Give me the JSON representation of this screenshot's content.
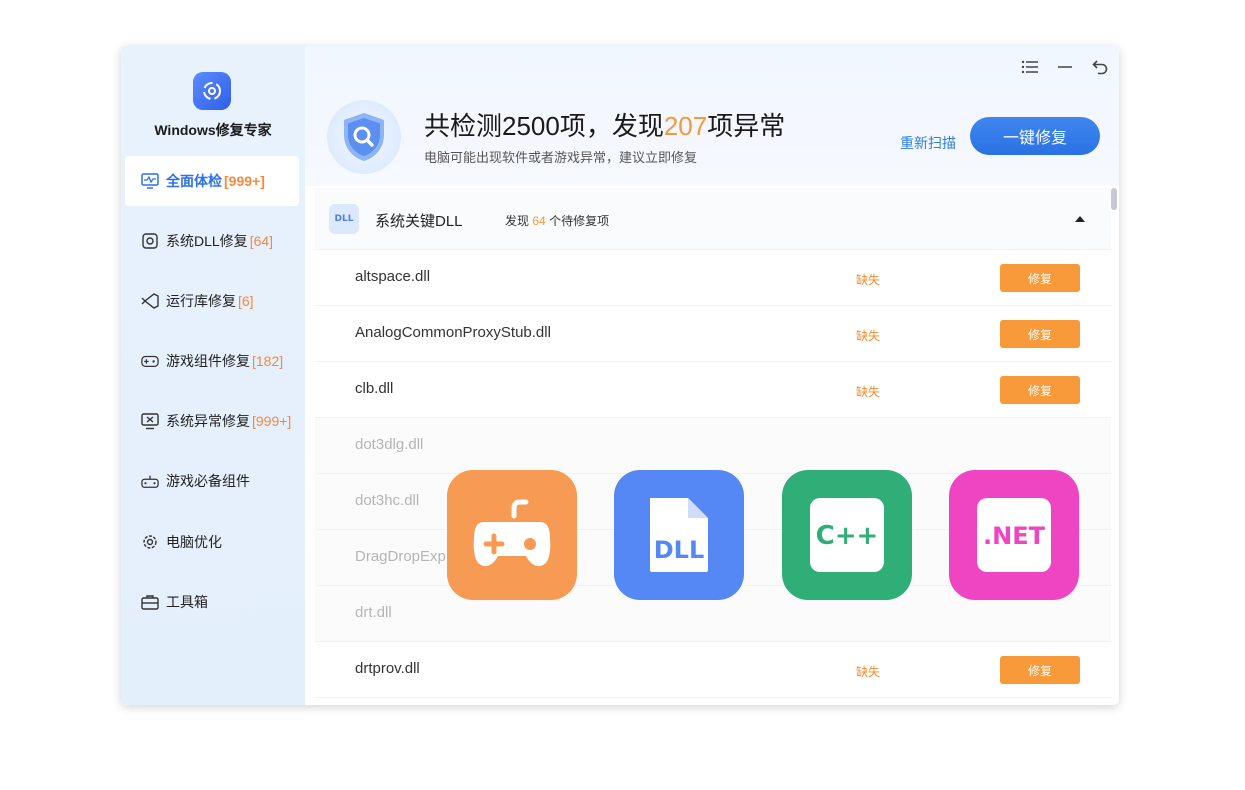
{
  "brand": {
    "title": "Windows修复专家",
    "logo_icon": "repair-gear-icon"
  },
  "sidebar": {
    "items": [
      {
        "label": "全面体检",
        "badge": "[999+]",
        "icon": "monitor-pulse-icon",
        "active": true
      },
      {
        "label": "系统DLL修复",
        "badge": "[64]",
        "icon": "dll-gear-icon"
      },
      {
        "label": "运行库修复",
        "badge": "[6]",
        "icon": "visual-studio-icon"
      },
      {
        "label": "游戏组件修复",
        "badge": "[182]",
        "icon": "gamepad-icon"
      },
      {
        "label": "系统异常修复",
        "badge": "[999+]",
        "icon": "monitor-error-icon"
      },
      {
        "label": "游戏必备组件",
        "badge": "",
        "icon": "joystick-icon"
      },
      {
        "label": "电脑优化",
        "badge": "",
        "icon": "gear-icon"
      },
      {
        "label": "工具箱",
        "badge": "",
        "icon": "toolbox-icon"
      }
    ]
  },
  "header": {
    "headline_prefix": "共检测2500项，发现",
    "headline_number": "207",
    "headline_suffix": "项异常",
    "subline": "电脑可能出现软件或者游戏异常，建议立即修复",
    "rescan_label": "重新扫描",
    "fix_all_label": "一键修复",
    "controls": [
      "menu-icon",
      "minimize-icon",
      "back-icon"
    ]
  },
  "group": {
    "chip_label": "DLL",
    "title": "系统关键DLL",
    "count_prefix": "发现",
    "count_number": "64",
    "count_suffix": "个待修复项"
  },
  "rows": [
    {
      "name": "altspace.dll",
      "status": "缺失",
      "action": "修复"
    },
    {
      "name": "AnalogCommonProxyStub.dll",
      "status": "缺失",
      "action": "修复"
    },
    {
      "name": "clb.dll",
      "status": "缺失",
      "action": "修复"
    },
    {
      "name": "dot3dlg.dll",
      "status": "",
      "action": ""
    },
    {
      "name": "dot3hc.dll",
      "status": "",
      "action": ""
    },
    {
      "name": "DragDropExp",
      "status": "",
      "action": ""
    },
    {
      "name": "drt.dll",
      "status": "",
      "action": ""
    },
    {
      "name": "drtprov.dll",
      "status": "缺失",
      "action": "修复"
    }
  ],
  "overlay_tiles": [
    {
      "icon": "gamepad-icon",
      "color": "#f79a54"
    },
    {
      "icon": "dll-file-icon",
      "label": "DLL",
      "color": "#5588f5"
    },
    {
      "icon": "cpp-icon",
      "label": "C++",
      "color": "#2fae78"
    },
    {
      "icon": "dotnet-icon",
      "label": ".NET",
      "color": "#ef45c3"
    }
  ],
  "colors": {
    "accent": "#2f6fe8",
    "warning": "#f99a3a",
    "sidebar_bg": "#e8f2fd"
  }
}
